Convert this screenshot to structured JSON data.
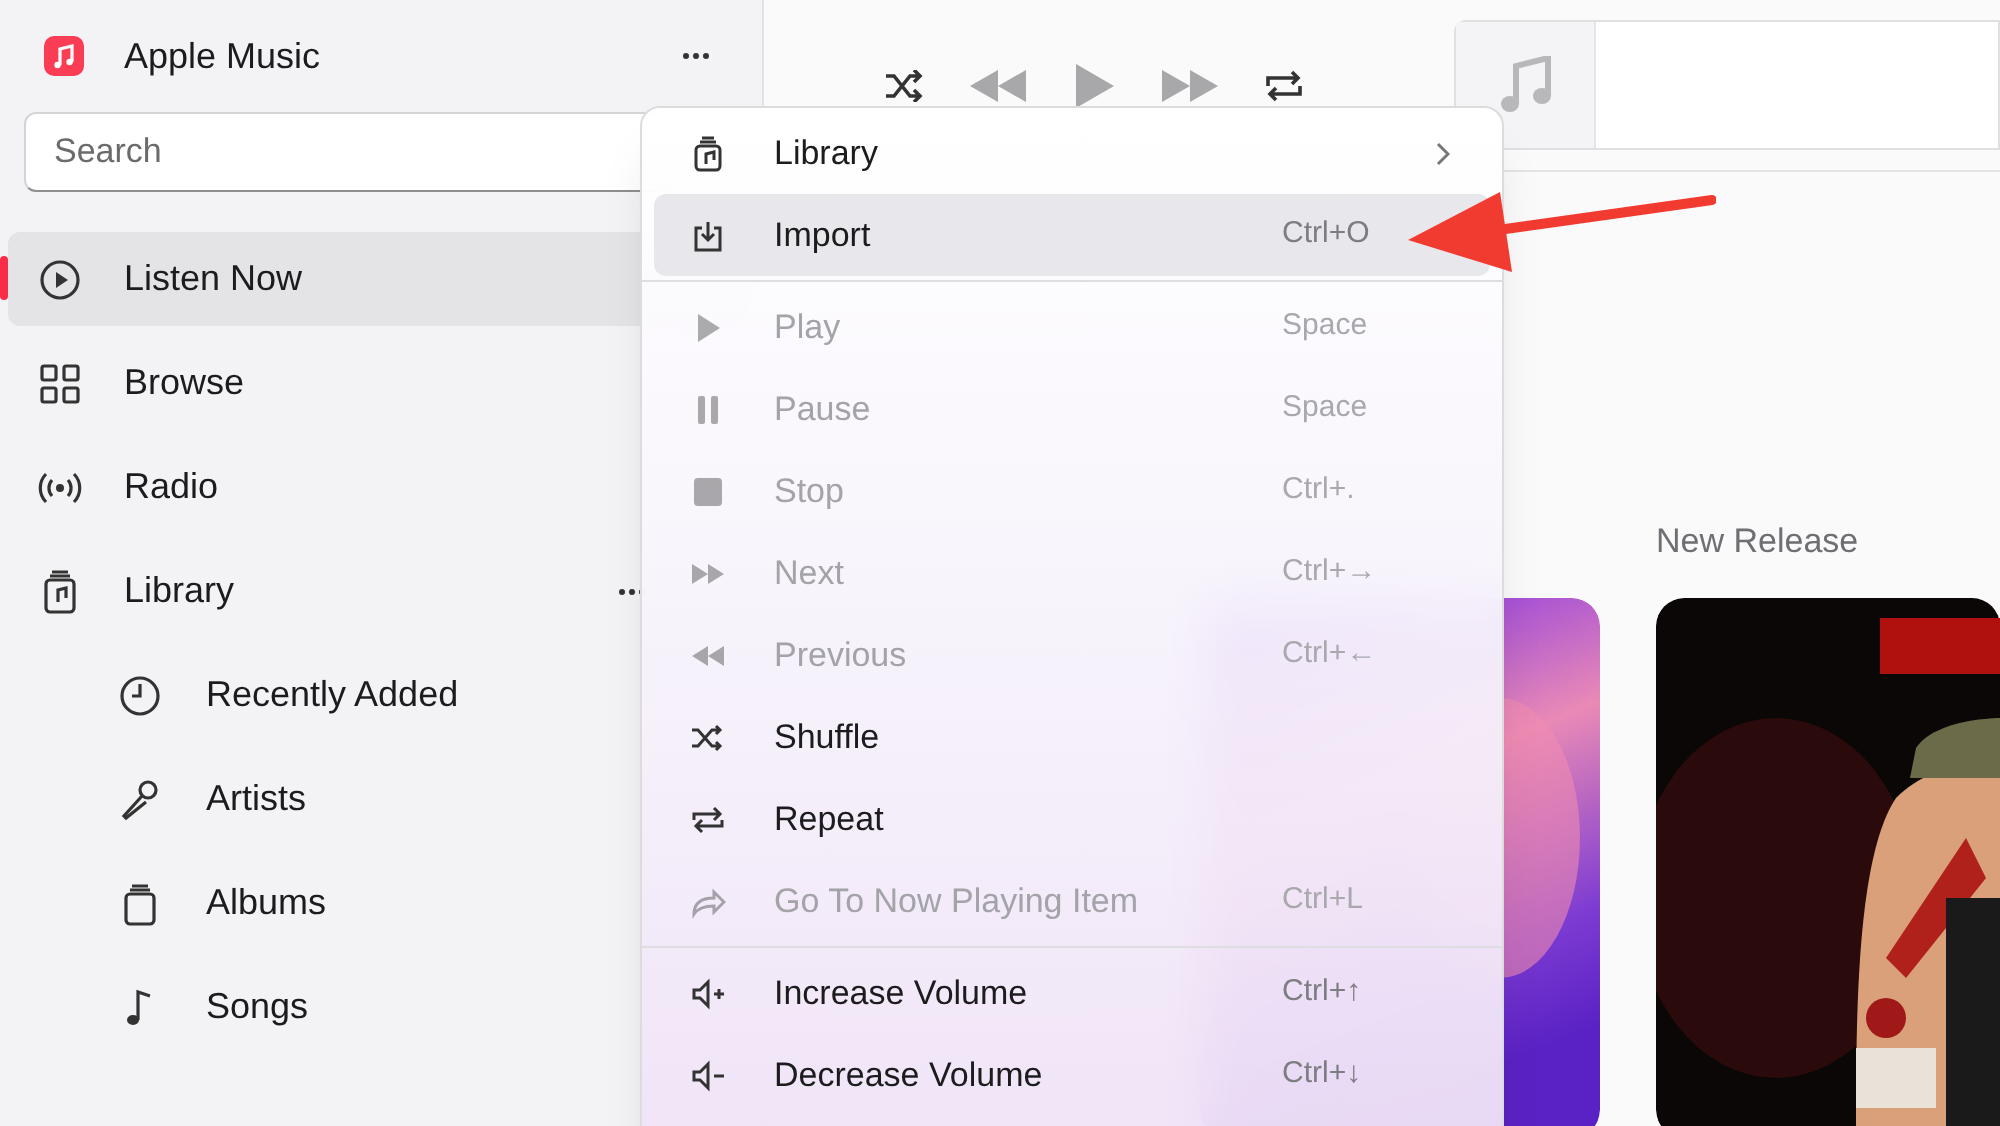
{
  "app": {
    "title": "Apple Music"
  },
  "search": {
    "placeholder": "Search"
  },
  "sidebar": {
    "items": [
      {
        "label": "Listen Now",
        "selected": true
      },
      {
        "label": "Browse",
        "selected": false
      },
      {
        "label": "Radio",
        "selected": false
      },
      {
        "label": "Library",
        "selected": false,
        "children": [
          {
            "label": "Recently Added",
            "selected": false
          },
          {
            "label": "Artists",
            "selected": false
          },
          {
            "label": "Albums",
            "selected": false
          },
          {
            "label": "Songs",
            "selected": false
          }
        ]
      }
    ]
  },
  "main": {
    "section_title": "New Release"
  },
  "menu": {
    "items": [
      {
        "label": "Library",
        "disabled": false,
        "selected": false,
        "submenu": true
      },
      {
        "label": "Import",
        "shortcut": "Ctrl+O",
        "disabled": false,
        "selected": true
      },
      {
        "label": "Play",
        "shortcut": "Space",
        "disabled": true,
        "selected": false,
        "separator_before": true
      },
      {
        "label": "Pause",
        "shortcut": "Space",
        "disabled": true,
        "selected": false
      },
      {
        "label": "Stop",
        "shortcut": "Ctrl+.",
        "disabled": true,
        "selected": false
      },
      {
        "label": "Next",
        "shortcut": "Ctrl+→",
        "disabled": true,
        "selected": false
      },
      {
        "label": "Previous",
        "shortcut": "Ctrl+←",
        "disabled": true,
        "selected": false
      },
      {
        "label": "Shuffle",
        "disabled": false,
        "selected": false
      },
      {
        "label": "Repeat",
        "disabled": false,
        "selected": false
      },
      {
        "label": "Go To Now Playing Item",
        "shortcut": "Ctrl+L",
        "disabled": true,
        "selected": false
      },
      {
        "label": "Increase Volume",
        "shortcut": "Ctrl+↑",
        "disabled": false,
        "selected": false,
        "separator_before": true
      },
      {
        "label": "Decrease Volume",
        "shortcut": "Ctrl+↓",
        "disabled": false,
        "selected": false
      }
    ]
  }
}
